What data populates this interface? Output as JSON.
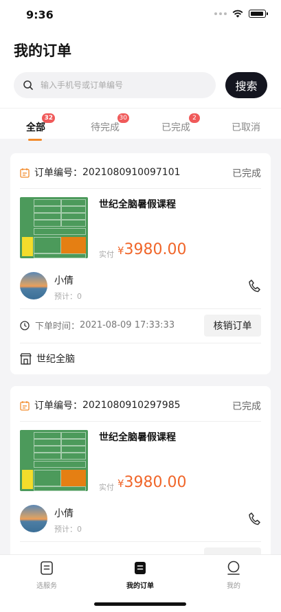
{
  "status_bar": {
    "time": "9:36"
  },
  "header": {
    "title": "我的订单"
  },
  "search": {
    "placeholder": "输入手机号或订单编号",
    "button_label": "搜索"
  },
  "tabs": [
    {
      "label": "全部",
      "badge": "32",
      "active": true
    },
    {
      "label": "待完成",
      "badge": "30",
      "active": false
    },
    {
      "label": "已完成",
      "badge": "2",
      "active": false
    },
    {
      "label": "已取消",
      "badge": "",
      "active": false
    }
  ],
  "orders": [
    {
      "order_label": "订单编号：",
      "order_no": "2021080910097101",
      "status": "已完成",
      "course_title": "世纪全脑暑假课程",
      "paid_label": "实付",
      "currency": "¥",
      "price": "3980.00",
      "user_name": "小倩",
      "user_sub": "预计：0",
      "time_label": "下单时间：",
      "time": "2021-08-09 17:33:33",
      "action_label": "核销订单",
      "store": "世纪全脑"
    },
    {
      "order_label": "订单编号：",
      "order_no": "2021080910297985",
      "status": "已完成",
      "course_title": "世纪全脑暑假课程",
      "paid_label": "实付",
      "currency": "¥",
      "price": "3980.00",
      "user_name": "小倩",
      "user_sub": "预计：0"
    }
  ],
  "bottom_nav": [
    {
      "label": "选服务",
      "icon": "service-icon",
      "active": false
    },
    {
      "label": "我的订单",
      "icon": "orders-icon",
      "active": true
    },
    {
      "label": "我的",
      "icon": "profile-icon",
      "active": false
    }
  ],
  "colors": {
    "accent": "#f28a2a",
    "price": "#f0662a",
    "badge": "#f05a5a",
    "search_button": "#14151f"
  }
}
